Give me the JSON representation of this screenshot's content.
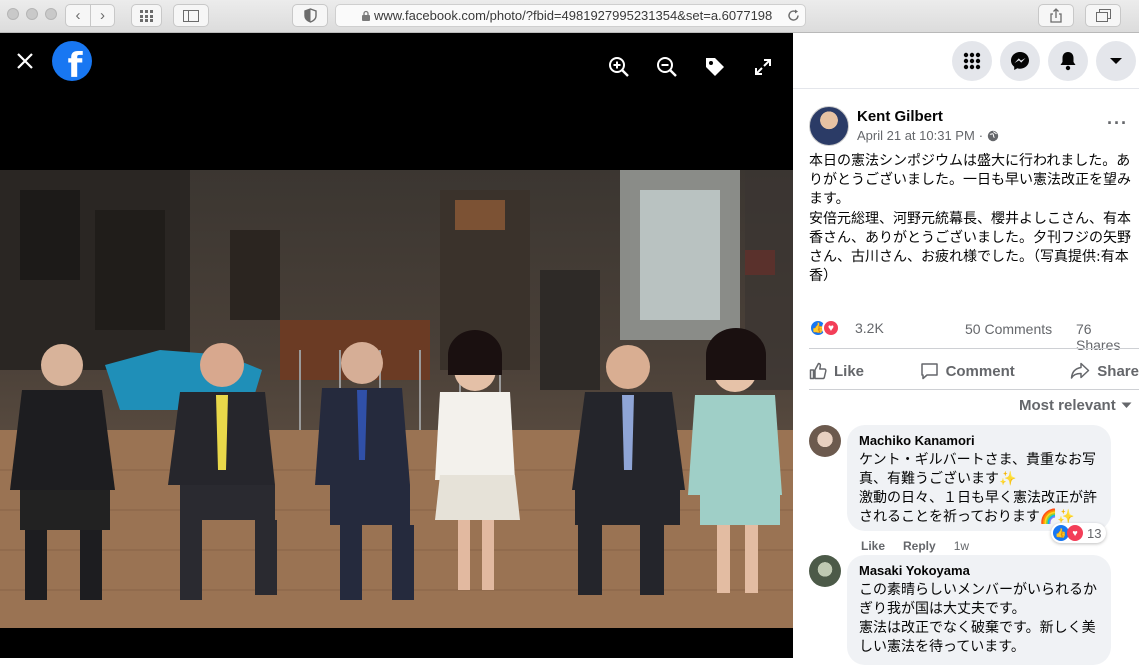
{
  "browser": {
    "url": "www.facebook.com/photo/?fbid=4981927995231354&set=a.6077198",
    "nav_back": "‹",
    "nav_forward": "›"
  },
  "viewer": {
    "tools": [
      "zoom-in-icon",
      "zoom-out-icon",
      "tag-icon",
      "fullscreen-icon"
    ],
    "photo_description_colors": {
      "floor": "#a9805c",
      "backdrop": "#3b3631"
    }
  },
  "post": {
    "author": "Kent Gilbert",
    "date": "April 21 at 10:31 PM",
    "date_sep": "·",
    "text": "本日の憲法シンポジウムは盛大に行われました。ありがとうございました。一日も早い憲法改正を望みます。\n安倍元総理、河野元統幕長、櫻井よしこさん、有本香さん、ありがとうございました。夕刊フジの矢野さん、古川さん、お疲れ様でした。（写真提供:有本香）",
    "reaction_count": "3.2K",
    "comments_count": "50 Comments",
    "shares_count": "76 Shares",
    "actions": {
      "like": "Like",
      "comment": "Comment",
      "share": "Share"
    },
    "sort_label": "Most relevant"
  },
  "comments": [
    {
      "name": "Machiko Kanamori",
      "text": "ケント・ギルバートさま、貴重なお写真、有難うございます✨\n激動の日々、１日も早く憲法改正が許されることを祈っております🌈✨",
      "like_label": "Like",
      "reply_label": "Reply",
      "time": "1w",
      "reactions": "13"
    },
    {
      "name": "Masaki Yokoyama",
      "text": "この素晴らしいメンバーがいられるかぎり我が国は大丈夫です。\n憲法は改正でなく破棄です。新しく美しい憲法を待っています。"
    }
  ],
  "colors": {
    "facebook_blue": "#1877f2",
    "love_red": "#f33e58",
    "muted": "#65676b"
  }
}
